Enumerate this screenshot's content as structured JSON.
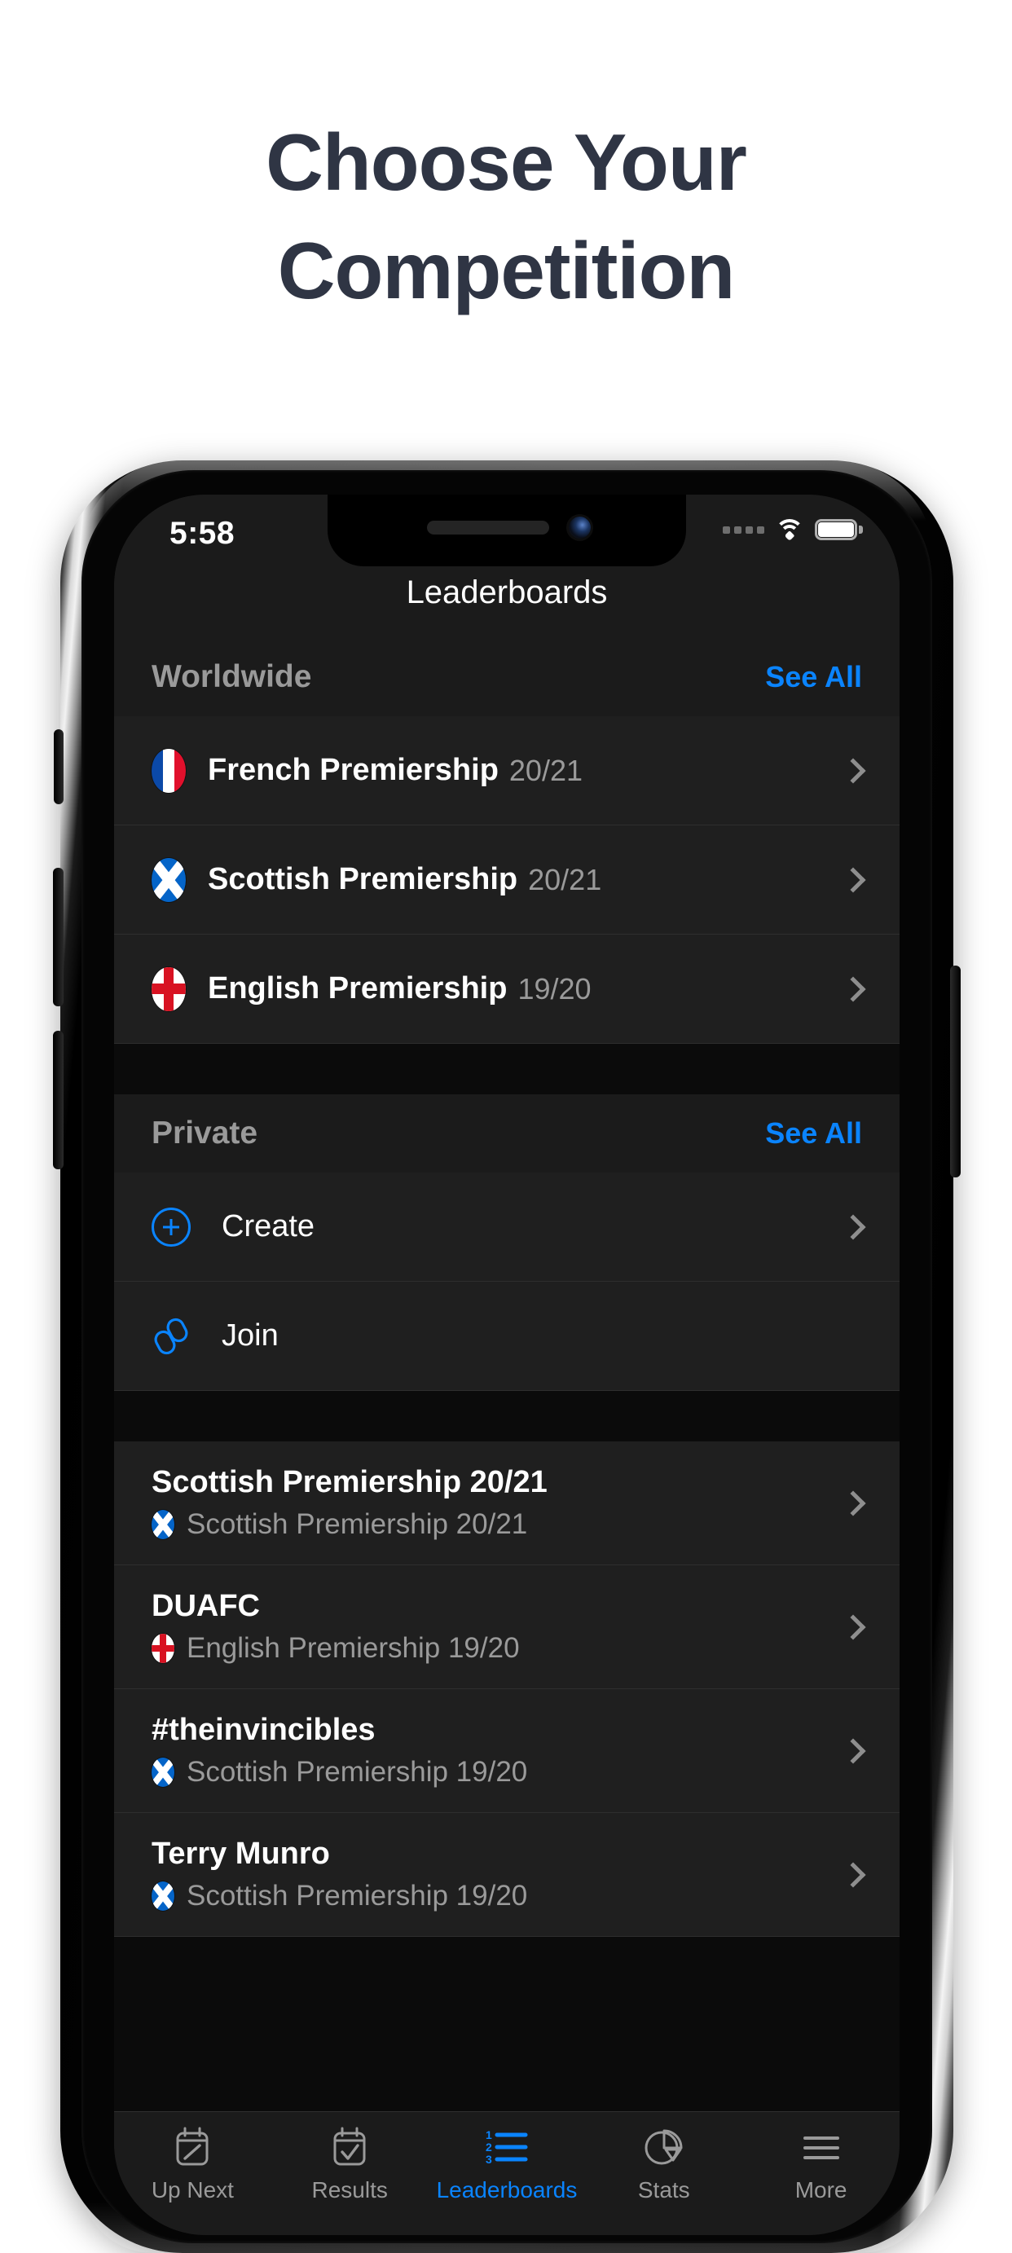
{
  "heading": {
    "line1": "Choose Your",
    "line2": "Competition"
  },
  "colors": {
    "heading_text": "#2f3544",
    "accent_blue": "#0a84ff",
    "screen_bg": "#0b0b0b",
    "row_bg": "#1f1f1f",
    "header_bg": "#1b1b1b",
    "secondary_text": "#9a9a9a"
  },
  "status_bar": {
    "time": "5:58",
    "cellular_icon": "signal-dots-icon",
    "wifi_icon": "wifi-icon",
    "battery_icon": "battery-full-icon"
  },
  "navbar": {
    "title": "Leaderboards"
  },
  "sections": [
    {
      "id": "worldwide",
      "title": "Worldwide",
      "action_label": "See All",
      "rows": [
        {
          "flag": "france-flag-icon",
          "name": "French Premiership",
          "season": "20/21",
          "chevron": true
        },
        {
          "flag": "scotland-flag-icon",
          "name": "Scottish Premiership",
          "season": "20/21",
          "chevron": true
        },
        {
          "flag": "england-flag-icon",
          "name": "English Premiership",
          "season": "19/20",
          "chevron": true
        }
      ]
    },
    {
      "id": "private",
      "title": "Private",
      "action_label": "See All",
      "actions": [
        {
          "icon": "plus-circle-icon",
          "label": "Create",
          "chevron": true
        },
        {
          "icon": "link-chain-icon",
          "label": "Join",
          "chevron": false
        }
      ]
    }
  ],
  "private_leagues": [
    {
      "title": "Scottish Premiership 20/21",
      "flag": "scotland-flag-icon",
      "subtitle": "Scottish Premiership 20/21"
    },
    {
      "title": "DUAFC",
      "flag": "england-flag-icon",
      "subtitle": "English Premiership 19/20"
    },
    {
      "title": "#theinvincibles",
      "flag": "scotland-flag-icon",
      "subtitle": "Scottish Premiership 19/20"
    },
    {
      "title": "Terry Munro",
      "flag": "scotland-flag-icon",
      "subtitle": "Scottish Premiership 19/20"
    }
  ],
  "tabbar": {
    "tabs": [
      {
        "icon": "pencil-square-icon",
        "label": "Up Next",
        "active": false
      },
      {
        "icon": "check-square-icon",
        "label": "Results",
        "active": false
      },
      {
        "icon": "numbered-list-icon",
        "label": "Leaderboards",
        "active": true
      },
      {
        "icon": "pie-chart-icon",
        "label": "Stats",
        "active": false
      },
      {
        "icon": "hamburger-menu-icon",
        "label": "More",
        "active": false
      }
    ]
  }
}
